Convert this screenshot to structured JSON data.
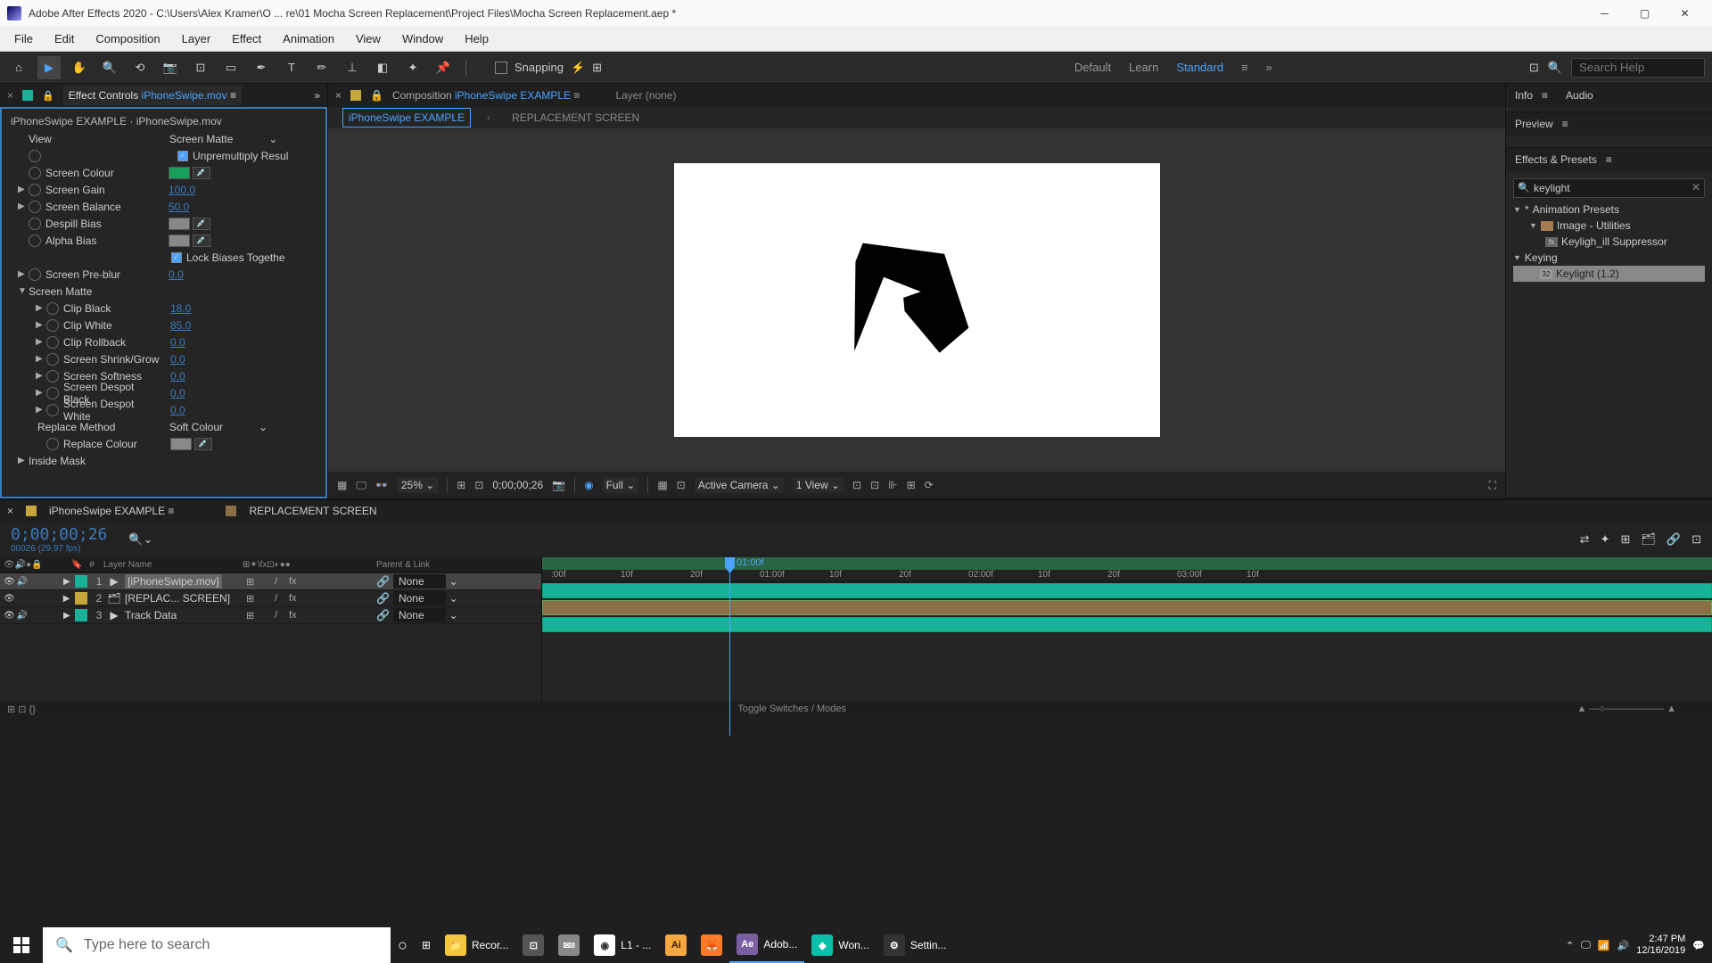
{
  "titlebar": {
    "title": "Adobe After Effects 2020 - C:\\Users\\Alex Kramer\\O ... re\\01 Mocha Screen Replacement\\Project Files\\Mocha Screen Replacement.aep *"
  },
  "menu": [
    "File",
    "Edit",
    "Composition",
    "Layer",
    "Effect",
    "Animation",
    "View",
    "Window",
    "Help"
  ],
  "toolbar": {
    "snapping": "Snapping",
    "workspaces": {
      "default": "Default",
      "learn": "Learn",
      "standard": "Standard"
    },
    "search_placeholder": "Search Help"
  },
  "effectControls": {
    "tabTitle": "Effect Controls",
    "tabTarget": "iPhoneSwipe.mov",
    "context": "iPhoneSwipe EXAMPLE · iPhoneSwipe.mov",
    "viewLabel": "View",
    "viewValue": "Screen Matte",
    "unpremultiply": "Unpremultiply Resul",
    "screenColour": "Screen Colour",
    "screenGain": "Screen Gain",
    "screenGainVal": "100.0",
    "screenBalance": "Screen Balance",
    "screenBalanceVal": "50.0",
    "despillBias": "Despill Bias",
    "alphaBias": "Alpha Bias",
    "lockBiases": "Lock Biases Togethe",
    "screenPreblur": "Screen Pre-blur",
    "screenPreblurVal": "0.0",
    "screenMatte": "Screen Matte",
    "clipBlack": "Clip Black",
    "clipBlackVal": "18.0",
    "clipWhite": "Clip White",
    "clipWhiteVal": "85.0",
    "clipRollback": "Clip Rollback",
    "clipRollbackVal": "0.0",
    "screenShrink": "Screen Shrink/Grow",
    "screenShrinkVal": "0.0",
    "screenSoftness": "Screen Softness",
    "screenSoftnessVal": "0.0",
    "despotBlack": "Screen Despot Black",
    "despotBlackVal": "0.0",
    "despotWhite": "Screen Despot White",
    "despotWhiteVal": "0.0",
    "replaceMethod": "Replace Method",
    "replaceMethodVal": "Soft Colour",
    "replaceColour": "Replace Colour",
    "insideMask": "Inside Mask"
  },
  "composition": {
    "tabTitle": "Composition",
    "tabTarget": "iPhoneSwipe EXAMPLE",
    "layerTab": "Layer  (none)",
    "sub1": "iPhoneSwipe EXAMPLE",
    "sub2": "REPLACEMENT SCREEN",
    "zoom": "25%",
    "timecode": "0;00;00;26",
    "resolution": "Full",
    "camera": "Active Camera",
    "views": "1 View"
  },
  "rightPanel": {
    "info": "Info",
    "audio": "Audio",
    "preview": "Preview",
    "effectsPresets": "Effects & Presets",
    "searchValue": "keylight",
    "animationPresets": "Animation Presets",
    "imageUtilities": "Image - Utilities",
    "keylightSuppressor": "Keyligh_ill Suppressor",
    "keying": "Keying",
    "keylight12": "Keylight (1.2)"
  },
  "timeline": {
    "tab1": "iPhoneSwipe EXAMPLE",
    "tab2": "REPLACEMENT SCREEN",
    "time": "0;00;00;26",
    "frames": "00026 (29.97 fps)",
    "cols": {
      "layerName": "Layer Name",
      "parentLink": "Parent & Link"
    },
    "layers": [
      {
        "num": "1",
        "name": "[iPhoneSwipe.mov]",
        "color": "#18b298",
        "parent": "None",
        "selected": true,
        "audio": true
      },
      {
        "num": "2",
        "name": "[REPLAC... SCREEN]",
        "color": "#c4a738",
        "parent": "None",
        "selected": false,
        "audio": false
      },
      {
        "num": "3",
        "name": "Track Data",
        "color": "#18b298",
        "parent": "None",
        "selected": false,
        "audio": true
      }
    ],
    "ticks": [
      ":00f",
      "10f",
      "20f",
      "01:00f",
      "10f",
      "20f",
      "02:00f",
      "10f",
      "20f",
      "03:00f",
      "10f"
    ],
    "playheadLabel": "01:00f",
    "toggleSwitches": "Toggle Switches / Modes"
  },
  "taskbar": {
    "searchPlaceholder": "Type here to search",
    "items": [
      "Recor...",
      "",
      "",
      "L1 - ...",
      "",
      "",
      "Adob...",
      "Won...",
      "Settin..."
    ],
    "time": "2:47 PM",
    "date": "12/16/2019"
  }
}
